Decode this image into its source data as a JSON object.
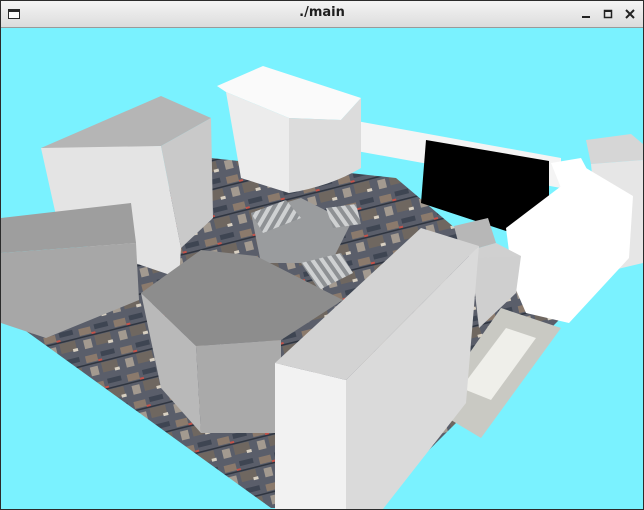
{
  "window": {
    "title": "./main",
    "app_icon": "window-icon",
    "controls": {
      "minimize_icon": "minimize-icon",
      "maximize_icon": "maximize-icon",
      "close_icon": "close-icon"
    }
  },
  "scene": {
    "sky_color": "#7af2ff",
    "ground": "aerial-photo-texture"
  }
}
